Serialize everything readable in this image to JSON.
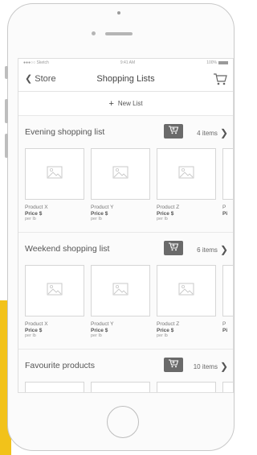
{
  "statusbar": {
    "carrier": "●●●○○ Sketch",
    "time": "9:41 AM",
    "battery": "100%"
  },
  "navbar": {
    "back_label": "Store",
    "title": "Shopping Lists"
  },
  "new_list_label": "New List",
  "lists": [
    {
      "name": "Evening shopping list",
      "count": "4 items",
      "products": [
        {
          "name": "Product X",
          "price": "Price $",
          "unit": "per lb"
        },
        {
          "name": "Product Y",
          "price": "Price $",
          "unit": "per lb"
        },
        {
          "name": "Product Z",
          "price": "Price $",
          "unit": "per lb"
        },
        {
          "name": "P",
          "price": "Pi",
          "unit": ""
        }
      ]
    },
    {
      "name": "Weekend shopping list",
      "count": "6 items",
      "products": [
        {
          "name": "Product X",
          "price": "Price $",
          "unit": "per lb"
        },
        {
          "name": "Product Y",
          "price": "Price $",
          "unit": "per lb"
        },
        {
          "name": "Product Z",
          "price": "Price $",
          "unit": "per lb"
        },
        {
          "name": "P",
          "price": "Pi",
          "unit": ""
        }
      ]
    },
    {
      "name": "Favourite products",
      "count": "10 items",
      "products": []
    }
  ],
  "colors": {
    "accent_yellow": "#f2c21a",
    "cart_button": "#6a6a6a"
  },
  "icons": {
    "back": "chevron-left-icon",
    "cart": "cart-icon",
    "add": "plus-icon",
    "image": "image-placeholder-icon",
    "chevron": "chevron-right-icon"
  }
}
